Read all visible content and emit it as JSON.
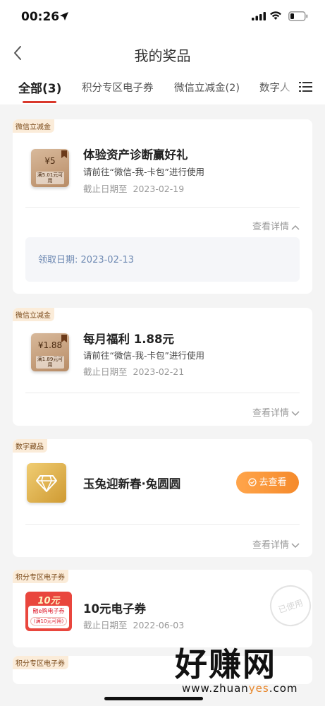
{
  "status_bar": {
    "time": "00:26"
  },
  "nav": {
    "title": "我的奖品"
  },
  "tabs": [
    {
      "label": "全部(3)",
      "active": true
    },
    {
      "label": "积分专区电子券",
      "active": false
    },
    {
      "label": "微信立减金(2)",
      "active": false
    },
    {
      "label": "数字人",
      "active": false
    }
  ],
  "cards": [
    {
      "tag": "微信立减金",
      "thumb_amount": "¥5",
      "thumb_condition": "满5.01元可用",
      "title": "体验资产诊断赢好礼",
      "instruction": "请前往“微信-我-卡包”进行使用",
      "expiry_label": "截止日期至",
      "expiry_date": "2023-02-19",
      "detail_label": "查看详情",
      "expanded": true,
      "claim_label": "领取日期:",
      "claim_date": "2023-02-13"
    },
    {
      "tag": "微信立减金",
      "thumb_amount": "¥1.88",
      "thumb_condition": "满1.89元可用",
      "title": "每月福利 1.88元",
      "instruction": "请前往“微信-我-卡包”进行使用",
      "expiry_label": "截止日期至",
      "expiry_date": "2023-02-21",
      "detail_label": "查看详情",
      "expanded": false
    },
    {
      "tag": "数字藏品",
      "title": "玉兔迎新春·兔圆圆",
      "button_label": "去查看",
      "detail_label": "查看详情",
      "expanded": false
    },
    {
      "tag": "积分专区电子券",
      "thumb_amount": "10元",
      "thumb_name": "融e购电子券",
      "thumb_condition": "(满10元可用)",
      "title": "10元电子券",
      "expiry_label": "截止日期至",
      "expiry_date": "2022-06-03",
      "stamp": "已使用"
    },
    {
      "tag": "积分专区电子券"
    }
  ],
  "watermark": {
    "text": "好赚网",
    "url_prefix": "www.zhuan",
    "url_highlight": "yes",
    "url_suffix": ".com"
  },
  "colors": {
    "accent": "#d9382b",
    "orange": "#f58a2b",
    "tag_bg": "#fbecd9"
  }
}
